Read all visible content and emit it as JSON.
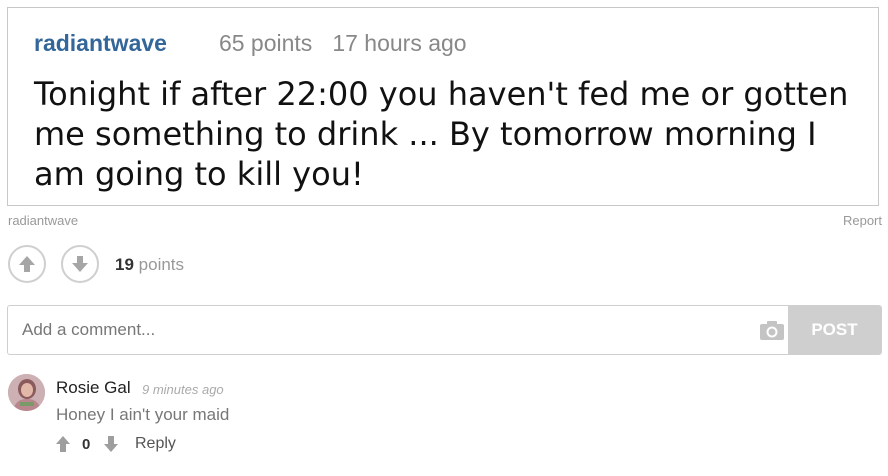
{
  "post": {
    "username": "radiantwave",
    "points": "65 points",
    "time": "17 hours ago",
    "text": "Tonight if after 22:00 you haven't fed me or gotten me something to drink ... By tomorrow morning I am going to kill you!"
  },
  "caption": {
    "username": "radiantwave",
    "report_label": "Report"
  },
  "votes": {
    "count": "19",
    "unit": "points",
    "upvote_icon": "arrow-up-icon",
    "downvote_icon": "arrow-down-icon"
  },
  "comment_form": {
    "placeholder": "Add a comment...",
    "value": "",
    "camera_icon": "camera-icon",
    "post_label": "POST"
  },
  "comments": [
    {
      "author": "Rosie Gal",
      "time": "9 minutes ago",
      "text": "Honey I ain't your maid",
      "score": "0",
      "reply_label": "Reply"
    }
  ],
  "colors": {
    "username": "#336699",
    "muted": "#999999",
    "post_button": "#cfcfcf",
    "border": "#cfcfcf"
  }
}
